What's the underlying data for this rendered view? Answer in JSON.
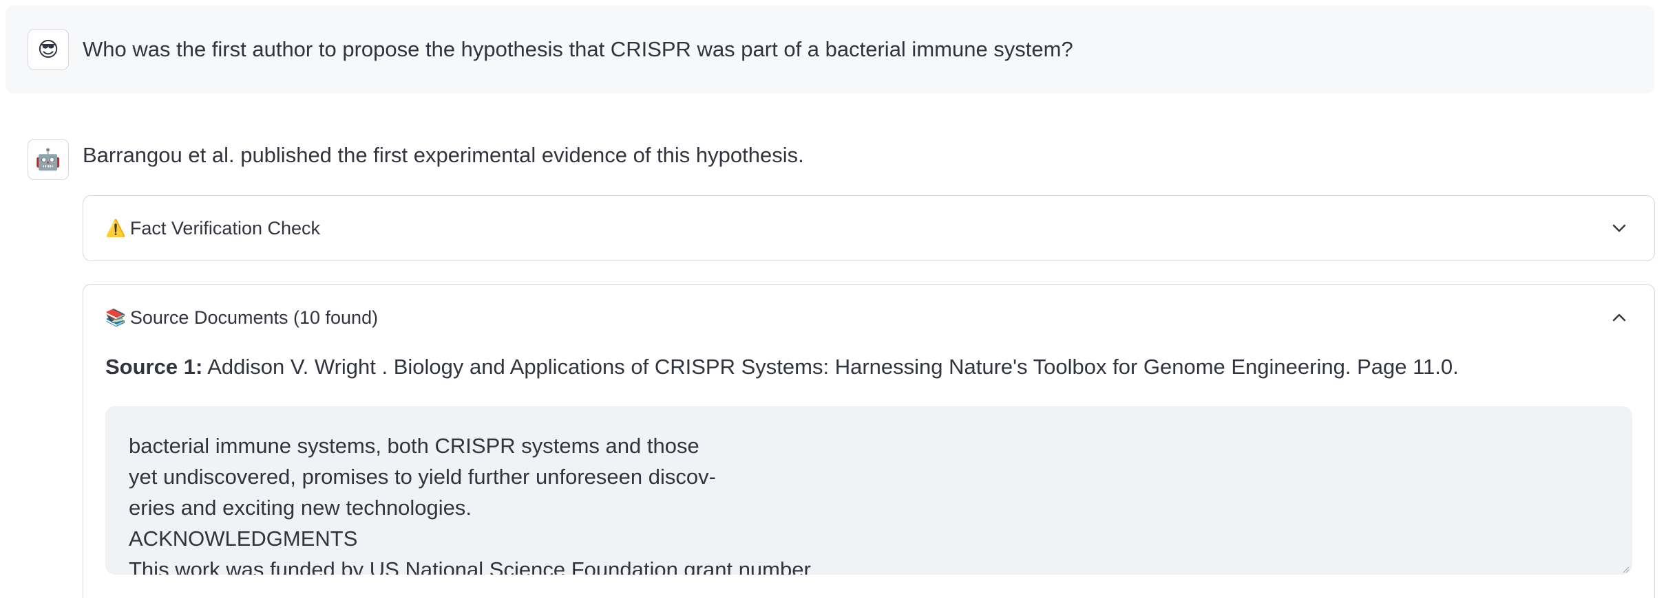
{
  "conversation": {
    "user_message": {
      "avatar_icon": "sunglasses-face-icon",
      "avatar_glyph": "😎",
      "text": "Who was the first author to propose the hypothesis that CRISPR was part of a bacterial immune system?"
    },
    "assistant_message": {
      "avatar_icon": "robot-icon",
      "avatar_glyph": "🤖",
      "text": "Barrangou et al. published the first experimental evidence of this hypothesis."
    },
    "fact_check": {
      "icon": "warning-icon",
      "icon_glyph": "⚠️",
      "label": "Fact Verification Check",
      "expanded": false
    },
    "source_documents": {
      "icon": "books-icon",
      "icon_glyph": "📚",
      "label": "Source Documents (10 found)",
      "expanded": true,
      "sources": [
        {
          "label": "Source 1:",
          "citation": "Addison V. Wright . Biology and Applications of CRISPR Systems: Harnessing Nature's Toolbox for Genome Engineering. Page 11.0.",
          "excerpt": "bacterial immune systems, both CRISPR systems and those\nyet undiscovered, promises to yield further unforeseen discov-\neries and exciting new technologies.\nACKNOWLEDGMENTS\nThis work was funded by US National Science Foundation grant number"
        }
      ]
    }
  }
}
